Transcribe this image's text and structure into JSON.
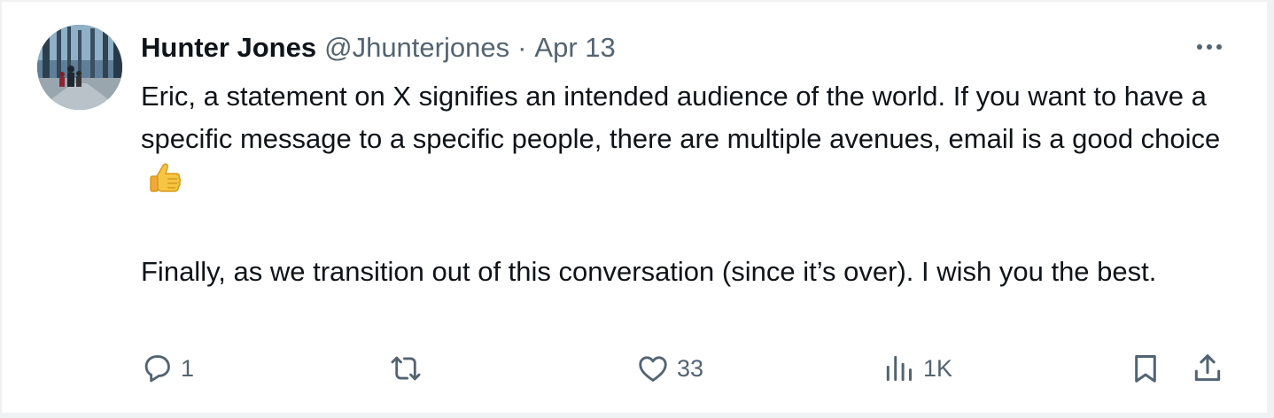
{
  "post": {
    "author": {
      "display_name": "Hunter Jones",
      "handle": "@Jhunterjones"
    },
    "separator": "·",
    "date": "Apr 13",
    "paragraphs": [
      "Eric, a statement on X signifies an intended audience of the world. If you want to have a specific message to a specific people, there are multiple avenues, email is a good choice",
      "Finally, as we transition out of this conversation (since it’s over). I wish you the best."
    ],
    "emoji": "thumbs-up",
    "actions": {
      "replies": "1",
      "reposts": "",
      "likes": "33",
      "views": "1K"
    }
  },
  "icons": {
    "more": "more-horizontal-icon",
    "reply": "reply-icon",
    "repost": "repost-icon",
    "like": "heart-icon",
    "views": "views-chart-icon",
    "bookmark": "bookmark-icon",
    "share": "share-icon"
  },
  "colors": {
    "text_primary": "#0f1419",
    "text_secondary": "#536471",
    "background": "#ffffff"
  }
}
